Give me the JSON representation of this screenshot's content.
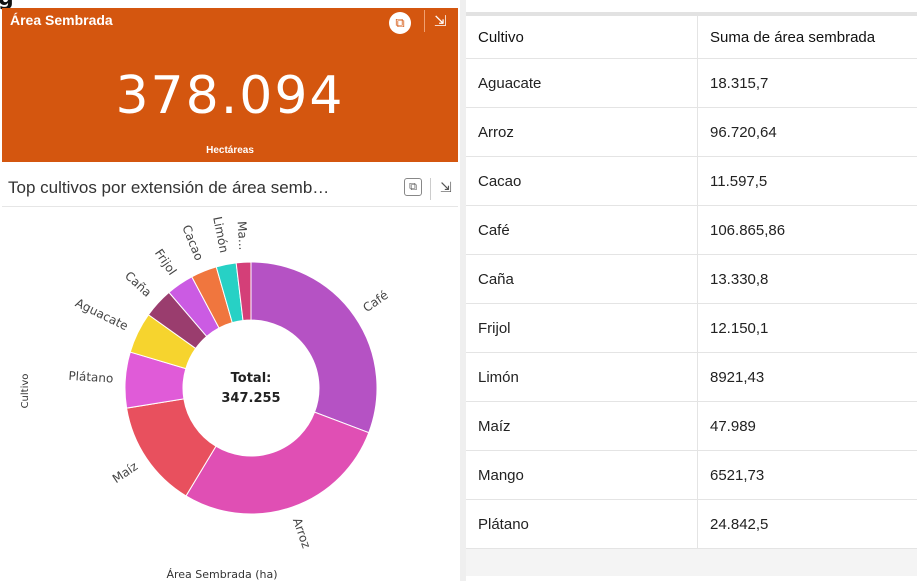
{
  "kpi": {
    "title": "Área Sembrada",
    "value": "378.094",
    "unit": "Hectáreas"
  },
  "chart_card": {
    "title": "Top cultivos por extensión de área semb…"
  },
  "chart_data": {
    "type": "pie",
    "donut": true,
    "center_label": "Total:",
    "center_value": "347.255",
    "ylabel": "Cultivo",
    "xlabel": "Área Sembrada (ha)",
    "categories": [
      "Café",
      "Arroz",
      "Maíz",
      "Plátano",
      "Aguacate",
      "Caña",
      "Frijol",
      "Cacao",
      "Limón",
      "Ma..."
    ],
    "values": [
      106865.86,
      96720.64,
      47989,
      24842.5,
      18315.7,
      13330.8,
      12150.1,
      11597.5,
      8921.43,
      6521.73
    ],
    "colors": [
      "#b552c4",
      "#e04fb4",
      "#e8505e",
      "#e05bd8",
      "#f6d42e",
      "#9a3d6e",
      "#cb5be3",
      "#f0763e",
      "#27d1c5",
      "#d43f78"
    ]
  },
  "table": {
    "headers": [
      "Cultivo",
      "Suma de área sembrada"
    ],
    "rows": [
      [
        "Aguacate",
        "18.315,7"
      ],
      [
        "Arroz",
        "96.720,64"
      ],
      [
        "Cacao",
        "11.597,5"
      ],
      [
        "Café",
        "106.865,86"
      ],
      [
        "Caña",
        "13.330,8"
      ],
      [
        "Frijol",
        "12.150,1"
      ],
      [
        "Limón",
        "8921,43"
      ],
      [
        "Maíz",
        "47.989"
      ],
      [
        "Mango",
        "6521,73"
      ],
      [
        "Plátano",
        "24.842,5"
      ]
    ]
  },
  "icons": {
    "toggle": "table-toggle-icon",
    "expand": "expand-icon"
  }
}
